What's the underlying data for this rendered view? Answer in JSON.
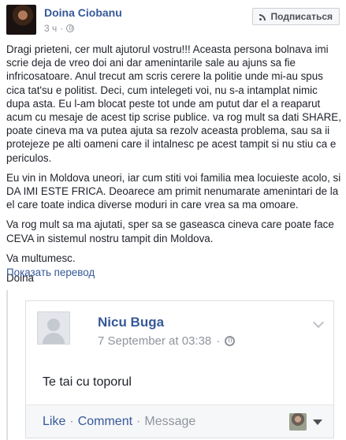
{
  "post": {
    "author": "Doina Ciobanu",
    "time": "3 ч",
    "separator": "·",
    "subscribe_label": "Подписаться",
    "paragraphs": [
      "Dragi prieteni, cer mult ajutorul vostru!!! Aceasta persona bolnava imi scrie deja de vreo doi ani dar amenintarile sale au ajuns sa fie infricosatoare. Anul trecut am scris cerere la politie unde mi-au spus cica tat'su e politist. Deci, cum intelegeti voi, nu s-a intamplat nimic dupa asta. Eu l-am blocat peste tot unde am putut dar el a reaparut acum cu mesaje de acest tip scrise publice. va rog mult sa dati SHARE, poate cineva ma va putea ajuta sa rezolv aceasta problema, sau sa ii protejeze pe alti oameni care il intalnesc pe acest tampit si nu stiu ca e periculos.",
      "Eu vin in Moldova uneori, iar cum stiti voi familia mea locuieste acolo, si DA IMI ESTE FRICA. Deoarece am primit nenumarate amenintari de la el care toate indica diverse moduri in care vrea sa ma omoare.",
      "Va rog mult sa ma ajutati, sper sa se gaseasca cineva care poate face CEVA in sistemul nostru tampit din Moldova.",
      "Va multumesc.",
      "Doina"
    ],
    "translate_link": "Показать перевод"
  },
  "embedded": {
    "author": "Nicu Buga",
    "time": "7 September at 03:38",
    "separator": "·",
    "text": "Te tai cu toporul",
    "actions": {
      "like": "Like",
      "comment": "Comment",
      "message": "Message",
      "separator": "·"
    }
  },
  "colors": {
    "link": "#365899",
    "meta": "#90949c",
    "text": "#1d2129"
  }
}
